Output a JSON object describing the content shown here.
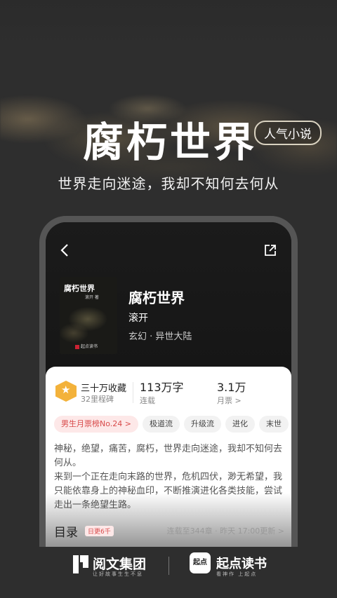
{
  "hero": {
    "title": "腐朽世界",
    "badge": "人气小说",
    "subtitle": "世界走向迷途，我却不知何去何从"
  },
  "phone": {
    "back_icon": "chevron-left-icon",
    "share_icon": "share-icon",
    "cover": {
      "title": "腐朽世界",
      "author": "滚开 著",
      "brand": "起点读书"
    },
    "book": {
      "title": "腐朽世界",
      "author": "滚开",
      "genre": "玄幻 · 异世大陆"
    },
    "stats": {
      "badge_title": "三十万收藏",
      "badge_sub": "32里程碑",
      "words_value": "113万字",
      "words_label": "连载",
      "votes_value": "3.1万",
      "votes_label": "月票 >"
    },
    "tags": [
      "男生月票榜No.24 >",
      "极道流",
      "升级流",
      "进化",
      "末世"
    ],
    "description": [
      "神秘，绝望，痛苦，腐朽，世界走向迷途，我却不知何去何从。",
      "来到一个正在走向末路的世界，危机四伏，渺无希望，我只能依靠身上的神秘血印，不断推演进化各类技能，尝试走出一条绝望生路。"
    ],
    "toc": {
      "title": "目录",
      "badge": "日更6千",
      "info": "连载至344章 · 昨天 17:00更新 >"
    }
  },
  "footer": {
    "yuewen_name": "阅文集团",
    "yuewen_slogan": "让好故事生生不息",
    "qidian_logo_text": "起点",
    "qidian_name": "起点读书",
    "qidian_slogan": "看神作 上起点"
  }
}
